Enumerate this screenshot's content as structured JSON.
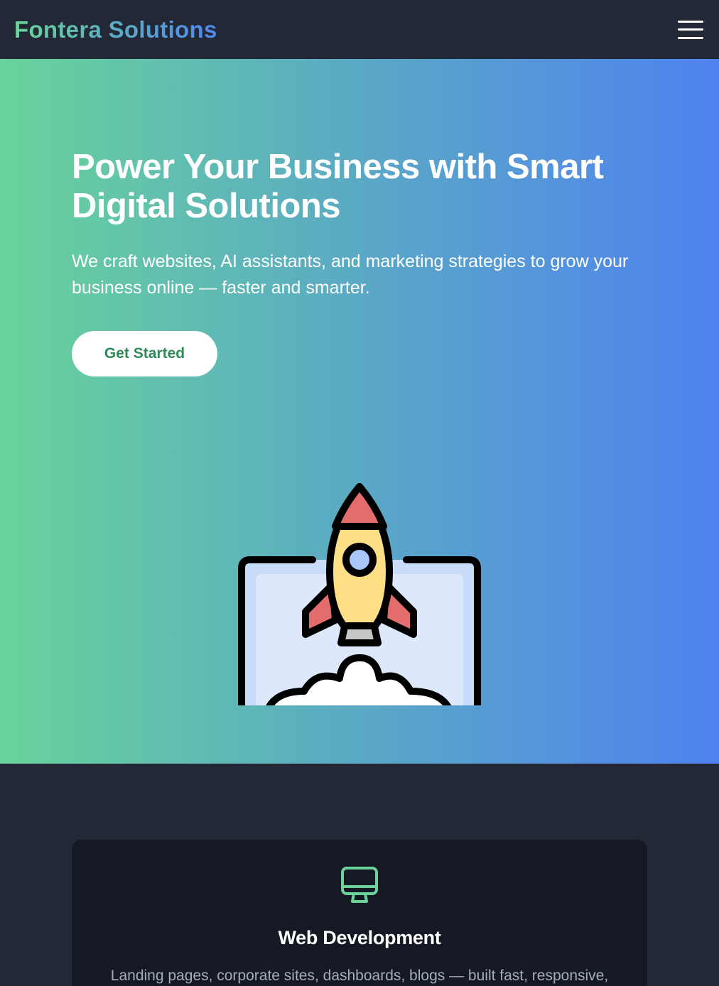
{
  "navbar": {
    "logo": "Fontera Solutions",
    "menu_icon": "hamburger-menu-icon"
  },
  "hero": {
    "title": "Power Your Business with Smart Digital Solutions",
    "subtitle": "We craft websites, AI assistants, and marketing strategies to grow your business online — faster and smarter.",
    "cta_label": "Get Started",
    "illustration_icon": "rocket-launch-laptop-icon"
  },
  "services": {
    "items": [
      {
        "icon": "monitor-icon",
        "title": "Web Development",
        "description": "Landing pages, corporate sites, dashboards, blogs — built fast, responsive,"
      }
    ]
  },
  "colors": {
    "nav_bg": "#222836",
    "gradient_start": "#68d39b",
    "gradient_end": "#4f82f0",
    "card_bg": "#141924",
    "accent_green": "#6bd39a",
    "cta_text": "#2f8a5a"
  }
}
